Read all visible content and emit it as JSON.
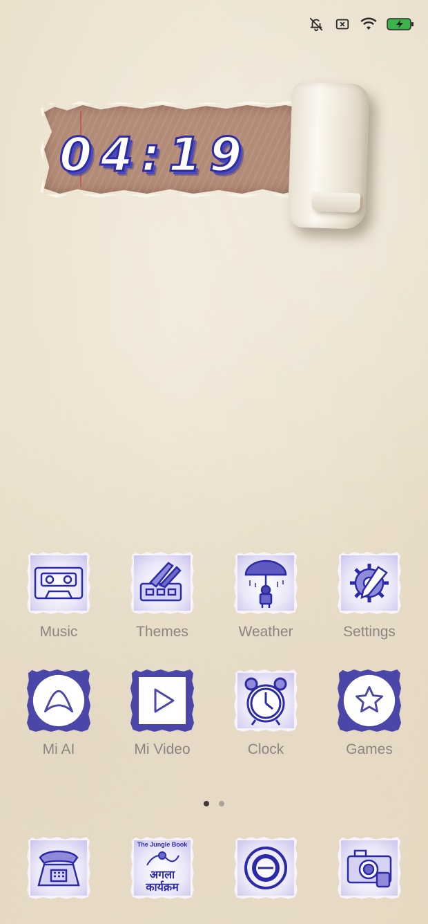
{
  "status_bar": {
    "icons": [
      "mute-icon",
      "no-sim-icon",
      "wifi-icon",
      "battery-charging-icon"
    ],
    "battery_color": "#3cb34a"
  },
  "clock_widget": {
    "time": "04:19",
    "ink_color": "#2b2aa8"
  },
  "apps": [
    {
      "label": "Music",
      "icon": "cassette-icon"
    },
    {
      "label": "Themes",
      "icon": "paint-brushes-icon"
    },
    {
      "label": "Weather",
      "icon": "umbrella-boy-icon"
    },
    {
      "label": "Settings",
      "icon": "gear-icon"
    },
    {
      "label": "Mi AI",
      "icon": "mi-ai-icon"
    },
    {
      "label": "Mi Video",
      "icon": "play-icon"
    },
    {
      "label": "Clock",
      "icon": "alarm-clock-icon"
    },
    {
      "label": "Games",
      "icon": "star-icon"
    }
  ],
  "page_indicator": {
    "pages": 2,
    "active": 1
  },
  "dock": [
    {
      "icon": "telephone-icon"
    },
    {
      "icon": "poster-icon",
      "line1": "The Jungle Book",
      "line2": "अगला",
      "line3": "कार्यक्रम"
    },
    {
      "icon": "doordarshan-icon"
    },
    {
      "icon": "camera-icon"
    }
  ],
  "colors": {
    "ink": "#2b2aa8",
    "label": "#8a8580",
    "paper": "#ece2cf"
  }
}
